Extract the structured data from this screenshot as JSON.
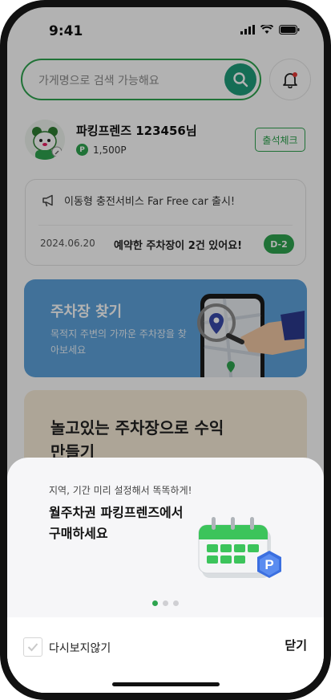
{
  "status_bar": {
    "time": "9:41"
  },
  "search": {
    "placeholder": "가게명으로 검색 가능해요"
  },
  "profile": {
    "name": "파킹프렌즈 123456님",
    "points": "1,500P",
    "coin_label": "P",
    "checkin_label": "출석체크"
  },
  "notice": {
    "announcement": "이동형 충전서비스 Far Free car 출시!",
    "date": "2024.06.20",
    "reservation_text": "예약한 주차장이 2건 있어요!",
    "dday_badge": "D-2"
  },
  "find_parking": {
    "title": "주차장 찾기",
    "description": "목적지 주변의 가까운 주차장을 찾아보세요"
  },
  "earn": {
    "title": "놀고있는 주차장으로 수익 만들기"
  },
  "sheet": {
    "subtitle": "지역, 기간 미리 설정해서 똑똑하게!",
    "headline": "월주차권 파킹프렌즈에서 구매하세요",
    "badge_letter": "P",
    "page_indicator": {
      "current": 1,
      "total": 3
    },
    "dont_show_again_label": "다시보지않기",
    "close_label": "닫기"
  },
  "colors": {
    "brand_green": "#2ea44f",
    "search_button": "#1f9d7a",
    "find_card": "#5da3db",
    "earn_card": "#f8ecd9"
  },
  "icons": [
    "search-icon",
    "bell-icon",
    "megaphone-icon",
    "location-pin-icon",
    "calendar-icon",
    "check-icon"
  ]
}
